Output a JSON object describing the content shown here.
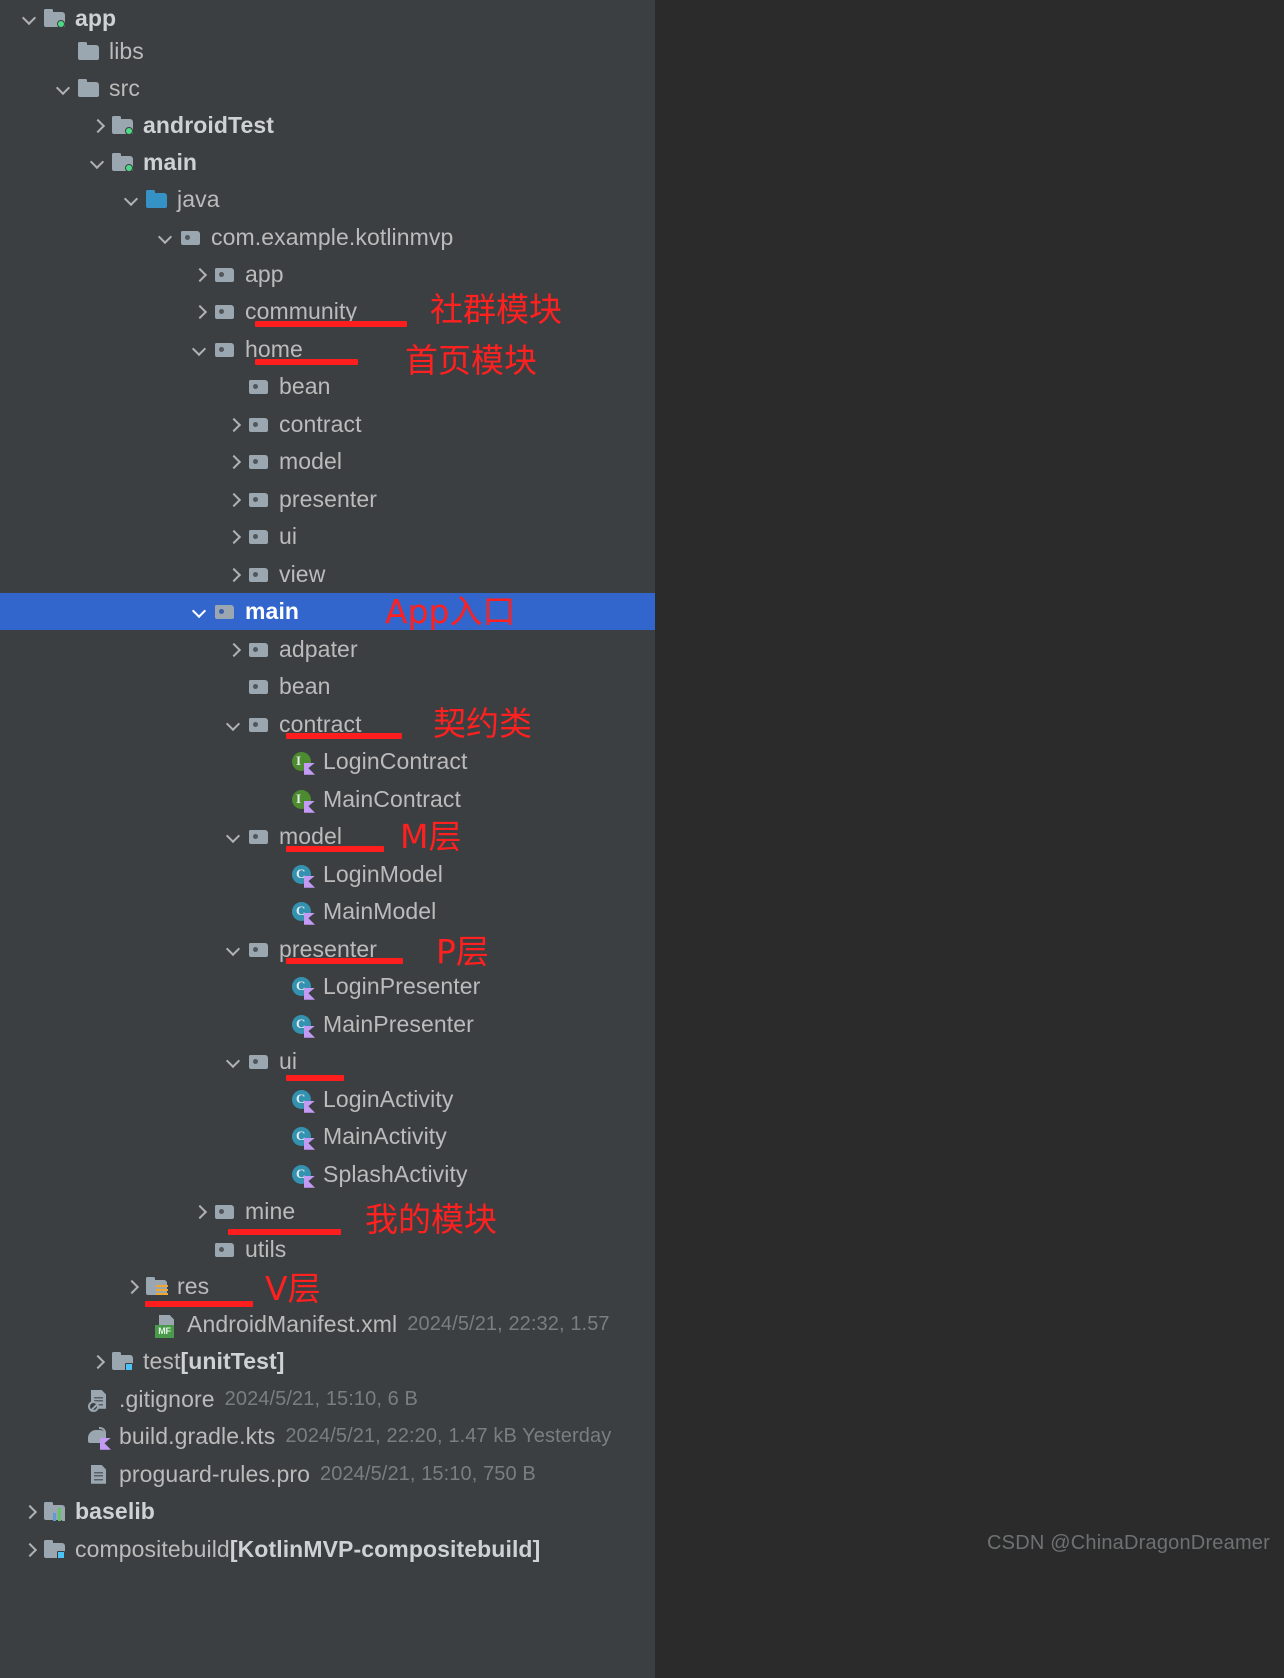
{
  "panel": {
    "background": "#3C3F41",
    "selection_color": "#3366CC",
    "rows": [
      {
        "label": "app",
        "meta": "",
        "suffix": ""
      },
      {
        "label": "libs",
        "meta": "",
        "suffix": ""
      },
      {
        "label": "src",
        "meta": "",
        "suffix": ""
      },
      {
        "label": "androidTest",
        "meta": "",
        "suffix": ""
      },
      {
        "label": "main",
        "meta": "",
        "suffix": ""
      },
      {
        "label": "java",
        "meta": "",
        "suffix": ""
      },
      {
        "label": "com.example.kotlinmvp",
        "meta": "",
        "suffix": ""
      },
      {
        "label": "app",
        "meta": "",
        "suffix": ""
      },
      {
        "label": "community",
        "meta": "",
        "suffix": ""
      },
      {
        "label": "home",
        "meta": "",
        "suffix": ""
      },
      {
        "label": "bean",
        "meta": "",
        "suffix": ""
      },
      {
        "label": "contract",
        "meta": "",
        "suffix": ""
      },
      {
        "label": "model",
        "meta": "",
        "suffix": ""
      },
      {
        "label": "presenter",
        "meta": "",
        "suffix": ""
      },
      {
        "label": "ui",
        "meta": "",
        "suffix": ""
      },
      {
        "label": "view",
        "meta": "",
        "suffix": ""
      },
      {
        "label": "main",
        "meta": "",
        "suffix": ""
      },
      {
        "label": "adpater",
        "meta": "",
        "suffix": ""
      },
      {
        "label": "bean",
        "meta": "",
        "suffix": ""
      },
      {
        "label": "contract",
        "meta": "",
        "suffix": ""
      },
      {
        "label": "LoginContract",
        "meta": "",
        "suffix": ""
      },
      {
        "label": "MainContract",
        "meta": "",
        "suffix": ""
      },
      {
        "label": "model",
        "meta": "",
        "suffix": ""
      },
      {
        "label": "LoginModel",
        "meta": "",
        "suffix": ""
      },
      {
        "label": "MainModel",
        "meta": "",
        "suffix": ""
      },
      {
        "label": "presenter",
        "meta": "",
        "suffix": ""
      },
      {
        "label": "LoginPresenter",
        "meta": "",
        "suffix": ""
      },
      {
        "label": "MainPresenter",
        "meta": "",
        "suffix": ""
      },
      {
        "label": "ui",
        "meta": "",
        "suffix": ""
      },
      {
        "label": "LoginActivity",
        "meta": "",
        "suffix": ""
      },
      {
        "label": "MainActivity",
        "meta": "",
        "suffix": ""
      },
      {
        "label": "SplashActivity",
        "meta": "",
        "suffix": ""
      },
      {
        "label": "mine",
        "meta": "",
        "suffix": ""
      },
      {
        "label": "utils",
        "meta": "",
        "suffix": ""
      },
      {
        "label": "res",
        "meta": "",
        "suffix": ""
      },
      {
        "label": "AndroidManifest.xml",
        "meta": "2024/5/21, 22:32, 1.57",
        "suffix": ""
      },
      {
        "label": "test ",
        "meta": "",
        "suffix": "[unitTest]"
      },
      {
        "label": ".gitignore",
        "meta": "2024/5/21, 15:10, 6 B",
        "suffix": ""
      },
      {
        "label": "build.gradle.kts",
        "meta": "2024/5/21, 22:20, 1.47 kB Yesterday",
        "suffix": ""
      },
      {
        "label": "proguard-rules.pro",
        "meta": "2024/5/21, 15:10, 750 B",
        "suffix": ""
      },
      {
        "label": "baselib",
        "meta": "",
        "suffix": ""
      },
      {
        "label": "compositebuild ",
        "meta": "",
        "suffix": "[KotlinMVP-compositebuild]"
      }
    ]
  },
  "annotations": {
    "color": "#FF2020",
    "notes": [
      {
        "text": "社群模块"
      },
      {
        "text": "首页模块"
      },
      {
        "text": "App入口"
      },
      {
        "text": "契约类"
      },
      {
        "text": "M层"
      },
      {
        "text": "P层"
      },
      {
        "text": "我的模块"
      },
      {
        "text": "V层"
      }
    ]
  },
  "watermark": {
    "text": "CSDN @ChinaDragonDreamer"
  }
}
